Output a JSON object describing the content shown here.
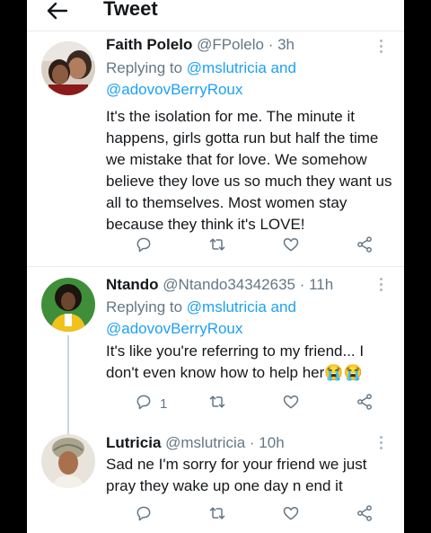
{
  "header": {
    "title": "Tweet"
  },
  "tweets": [
    {
      "name": "Faith Polelo",
      "handle": "@FPolelo",
      "dot": " · ",
      "time": "3h",
      "replying_prefix": "Replying to ",
      "replying_first": "@mslutricia",
      "replying_and": " and",
      "replying_second": "@adovovBerryRoux",
      "text": "It's the isolation for me. The minute it happens, girls gotta run but half the time we mistake that for love. We somehow believe they love us so much they want us all to themselves. Most women stay because they think it's LOVE!",
      "reply_count": ""
    },
    {
      "name": "Ntando",
      "handle": "@Ntando34342635",
      "dot": " · ",
      "time": "11h",
      "replying_prefix": "Replying to ",
      "replying_first": "@mslutricia",
      "replying_and": " and",
      "replying_second": "@adovovBerryRoux",
      "text": "It's like you're referring to my friend... I don't even know how to help her😭😭",
      "reply_count": "1"
    },
    {
      "name": "Lutricia",
      "handle": "@mslutricia",
      "dot": " · ",
      "time": "10h",
      "text": "Sad ne I'm sorry for your friend we just pray they wake up one day n end it",
      "reply_count": ""
    }
  ],
  "colors": {
    "link": "#1da1f2",
    "meta": "#657786",
    "icon": "#657786"
  },
  "icons": [
    "back-arrow",
    "reply",
    "retweet",
    "like",
    "share",
    "more-vertical"
  ]
}
